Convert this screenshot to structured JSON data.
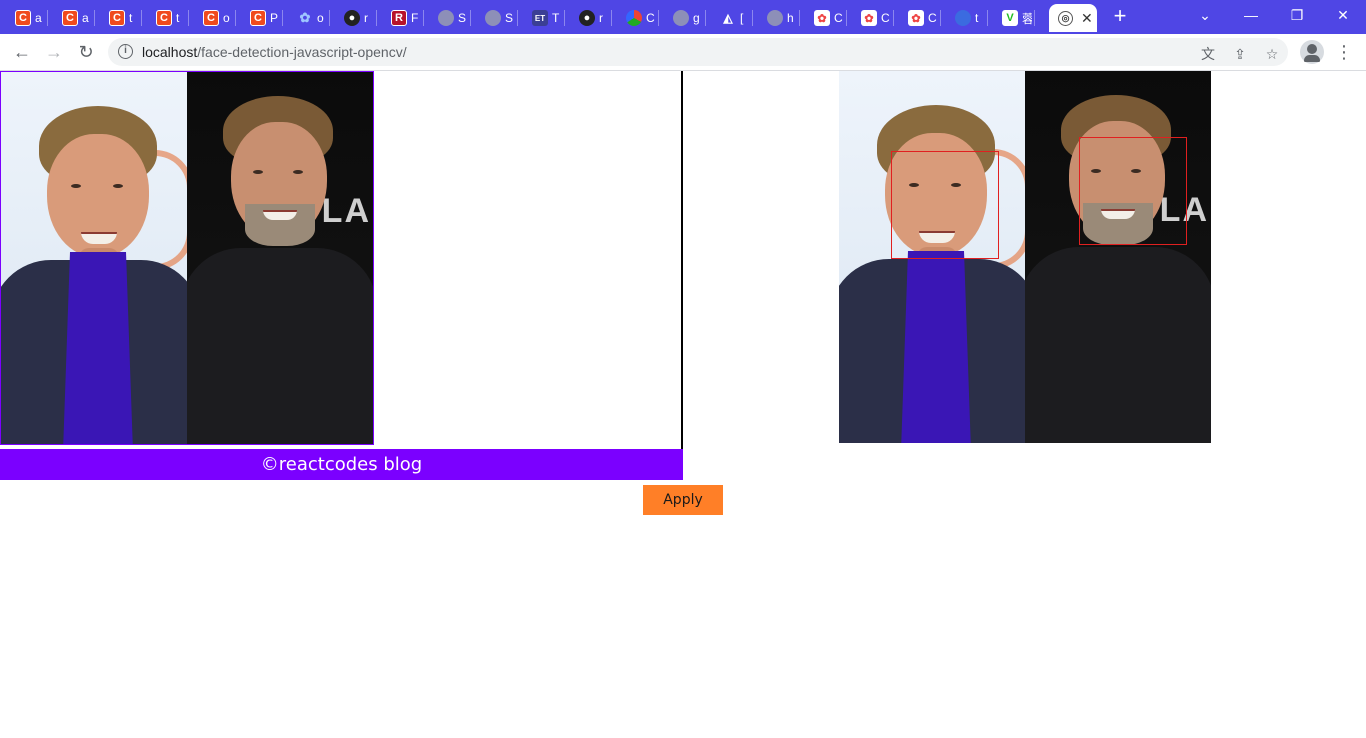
{
  "browser": {
    "tabs": [
      {
        "icon": "csdn-icon",
        "title": "a"
      },
      {
        "icon": "csdn-icon",
        "title": "a"
      },
      {
        "icon": "csdn-icon",
        "title": "t"
      },
      {
        "icon": "csdn-icon",
        "title": "t"
      },
      {
        "icon": "csdn-icon",
        "title": "o"
      },
      {
        "icon": "csdn-icon",
        "title": "P"
      },
      {
        "icon": "baidu-icon",
        "title": "o"
      },
      {
        "icon": "github-icon",
        "title": "r"
      },
      {
        "icon": "r-icon",
        "title": "F"
      },
      {
        "icon": "globe-icon",
        "title": "S"
      },
      {
        "icon": "globe-icon",
        "title": "S"
      },
      {
        "icon": "et-icon",
        "title": "T"
      },
      {
        "icon": "github-icon",
        "title": "r"
      },
      {
        "icon": "multicolor-icon",
        "title": "C"
      },
      {
        "icon": "globe-icon",
        "title": "g"
      },
      {
        "icon": "triangle-icon",
        "title": "["
      },
      {
        "icon": "globe-icon",
        "title": "h"
      },
      {
        "icon": "check-icon",
        "title": "C"
      },
      {
        "icon": "check-icon",
        "title": "C"
      },
      {
        "icon": "check-icon",
        "title": "C"
      },
      {
        "icon": "blue-globe-icon",
        "title": "t"
      },
      {
        "icon": "v-icon",
        "title": "蓉"
      }
    ],
    "active_tab_close": "✕",
    "new_tab": "+",
    "url_host": "localhost",
    "url_path": "/face-detection-javascript-opencv/"
  },
  "page": {
    "footer_text": "©reactcodes blog",
    "apply_label": "Apply"
  },
  "colors": {
    "tab_strip": "#4f46e5",
    "footer_bar": "#7b00ff",
    "apply_button": "#ff7f27",
    "face_box": "#e02020"
  }
}
